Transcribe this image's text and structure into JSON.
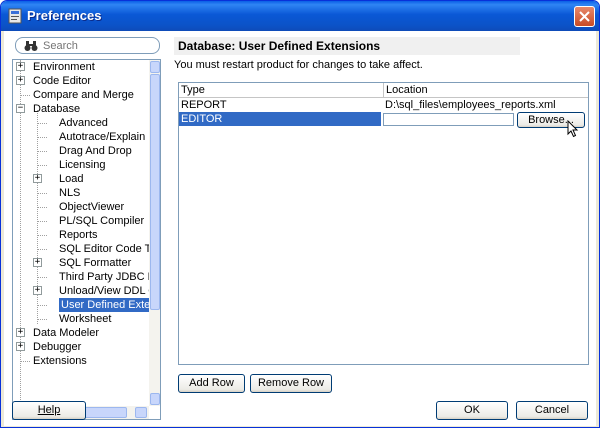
{
  "window": {
    "title": "Preferences",
    "icon": "preferences-app-icon"
  },
  "search": {
    "placeholder": "Search",
    "icon": "binoculars-icon"
  },
  "tree": {
    "items": [
      {
        "label": "Environment",
        "expander": "+"
      },
      {
        "label": "Code Editor",
        "expander": "+"
      },
      {
        "label": "Compare and Merge",
        "expander": ""
      },
      {
        "label": "Database",
        "expander": "-"
      },
      {
        "label": "Advanced",
        "expander": ""
      },
      {
        "label": "Autotrace/Explain Plan",
        "expander": ""
      },
      {
        "label": "Drag And Drop",
        "expander": ""
      },
      {
        "label": "Licensing",
        "expander": ""
      },
      {
        "label": "Load",
        "expander": "+"
      },
      {
        "label": "NLS",
        "expander": ""
      },
      {
        "label": "ObjectViewer",
        "expander": ""
      },
      {
        "label": "PL/SQL Compiler",
        "expander": ""
      },
      {
        "label": "Reports",
        "expander": ""
      },
      {
        "label": "SQL Editor Code Templa",
        "expander": ""
      },
      {
        "label": "SQL Formatter",
        "expander": "+"
      },
      {
        "label": "Third Party JDBC Driver",
        "expander": ""
      },
      {
        "label": "Unload/View DDL Optior",
        "expander": "+"
      },
      {
        "label": "User Defined Extension",
        "expander": "",
        "selected": true
      },
      {
        "label": "Worksheet",
        "expander": ""
      },
      {
        "label": "Data Modeler",
        "expander": "+"
      },
      {
        "label": "Debugger",
        "expander": "+"
      },
      {
        "label": "Extensions",
        "expander": ""
      }
    ]
  },
  "page": {
    "title": "Database: User Defined Extensions",
    "restart_message": "You must restart product for changes to take affect."
  },
  "table": {
    "headers": [
      "Type",
      "Location"
    ],
    "rows": [
      {
        "type": "REPORT",
        "location": "D:\\sql_files\\employees_reports.xml"
      },
      {
        "type": "EDITOR",
        "location": ""
      }
    ],
    "browse_label": "Browse..."
  },
  "buttons": {
    "add_row": "Add Row",
    "remove_row": "Remove Row",
    "help": "Help",
    "ok": "OK",
    "cancel": "Cancel"
  }
}
